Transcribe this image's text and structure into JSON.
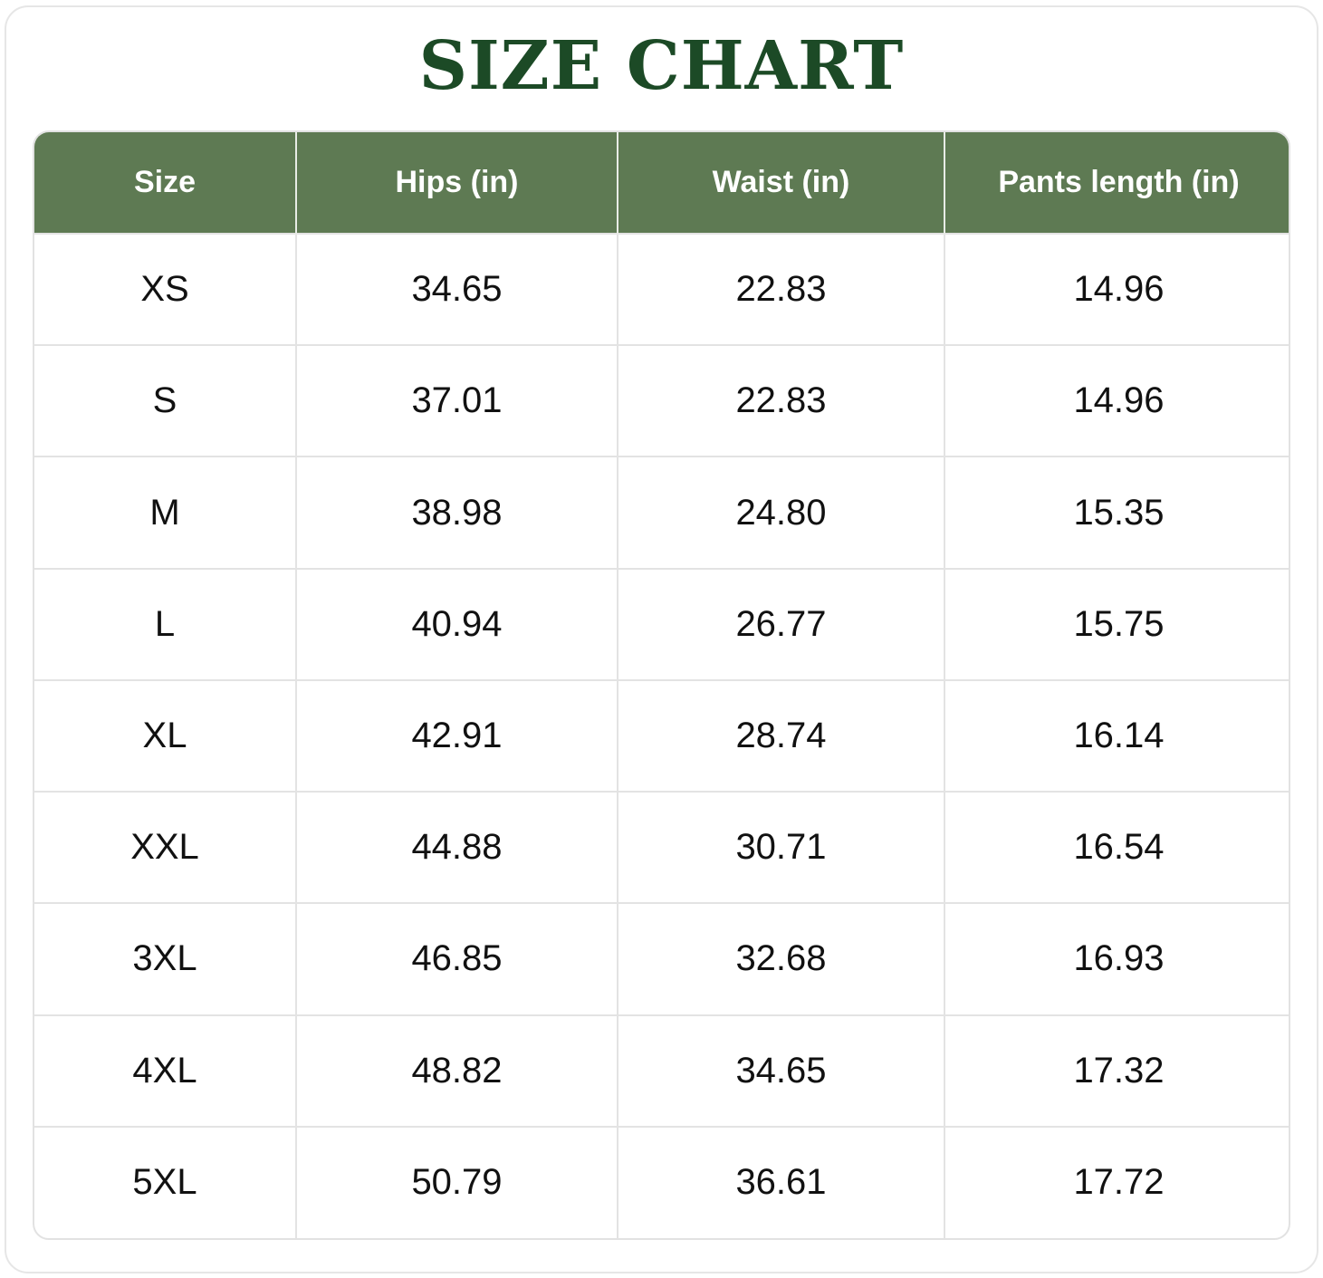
{
  "title": "SIZE CHART",
  "header_color": "#5e7a53",
  "title_color": "#1c4a26",
  "columns": [
    "Size",
    "Hips (in)",
    "Waist (in)",
    "Pants length (in)"
  ],
  "rows": [
    [
      "XS",
      "34.65",
      "22.83",
      "14.96"
    ],
    [
      "S",
      "37.01",
      "22.83",
      "14.96"
    ],
    [
      "M",
      "38.98",
      "24.80",
      "15.35"
    ],
    [
      "L",
      "40.94",
      "26.77",
      "15.75"
    ],
    [
      "XL",
      "42.91",
      "28.74",
      "16.14"
    ],
    [
      "XXL",
      "44.88",
      "30.71",
      "16.54"
    ],
    [
      "3XL",
      "46.85",
      "32.68",
      "16.93"
    ],
    [
      "4XL",
      "48.82",
      "34.65",
      "17.32"
    ],
    [
      "5XL",
      "50.79",
      "36.61",
      "17.72"
    ]
  ]
}
